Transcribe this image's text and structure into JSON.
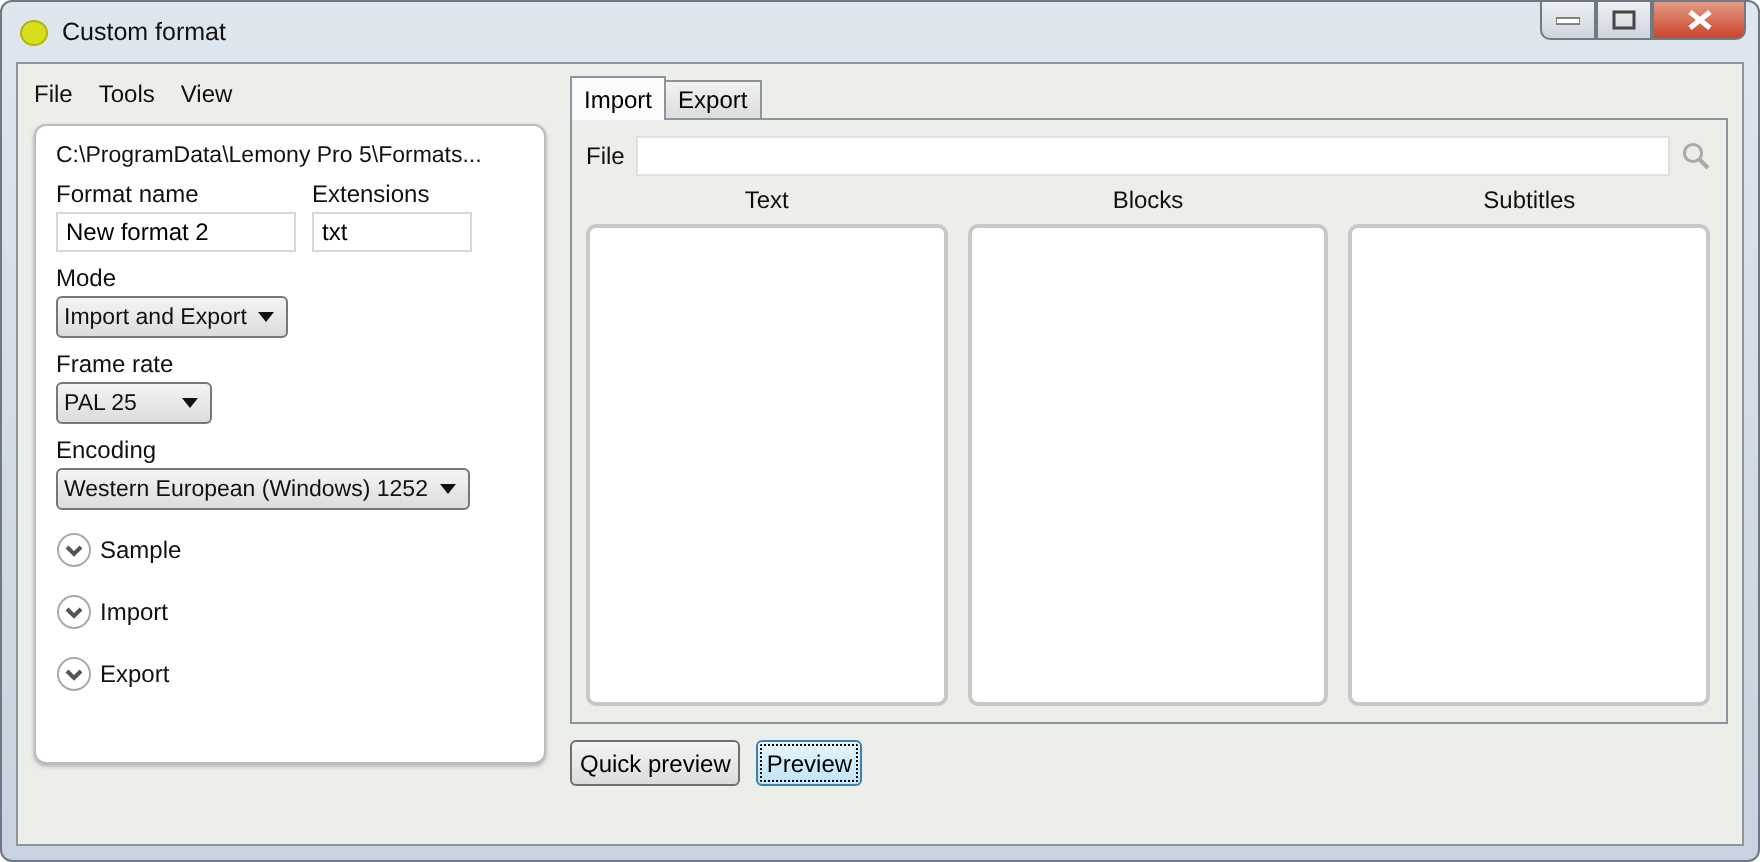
{
  "window": {
    "title": "Custom format"
  },
  "menu": [
    "File",
    "Tools",
    "View"
  ],
  "settings": {
    "path": "C:\\ProgramData\\Lemony Pro 5\\Formats...",
    "format_name": {
      "label": "Format name",
      "value": "New format 2"
    },
    "extensions": {
      "label": "Extensions",
      "value": "txt"
    },
    "dropdowns": [
      {
        "label": "Mode",
        "value": "Import and Export"
      },
      {
        "label": "Frame rate",
        "value": "PAL 25"
      },
      {
        "label": "Encoding",
        "value": "Western European (Windows) 1252"
      }
    ],
    "sections": [
      {
        "label": "Sample",
        "expanded": false
      },
      {
        "label": "Import",
        "expanded": false
      },
      {
        "label": "Export",
        "expanded": false
      }
    ]
  },
  "tabs": [
    {
      "label": "Import",
      "selected": true
    },
    {
      "label": "Export",
      "selected": false
    }
  ],
  "file_field": {
    "label": "File"
  },
  "columns": [
    "Text",
    "Blocks",
    "Subtitles"
  ],
  "buttons": [
    {
      "label": "Quick preview",
      "focused": false
    },
    {
      "label": "Preview",
      "focused": true
    }
  ]
}
